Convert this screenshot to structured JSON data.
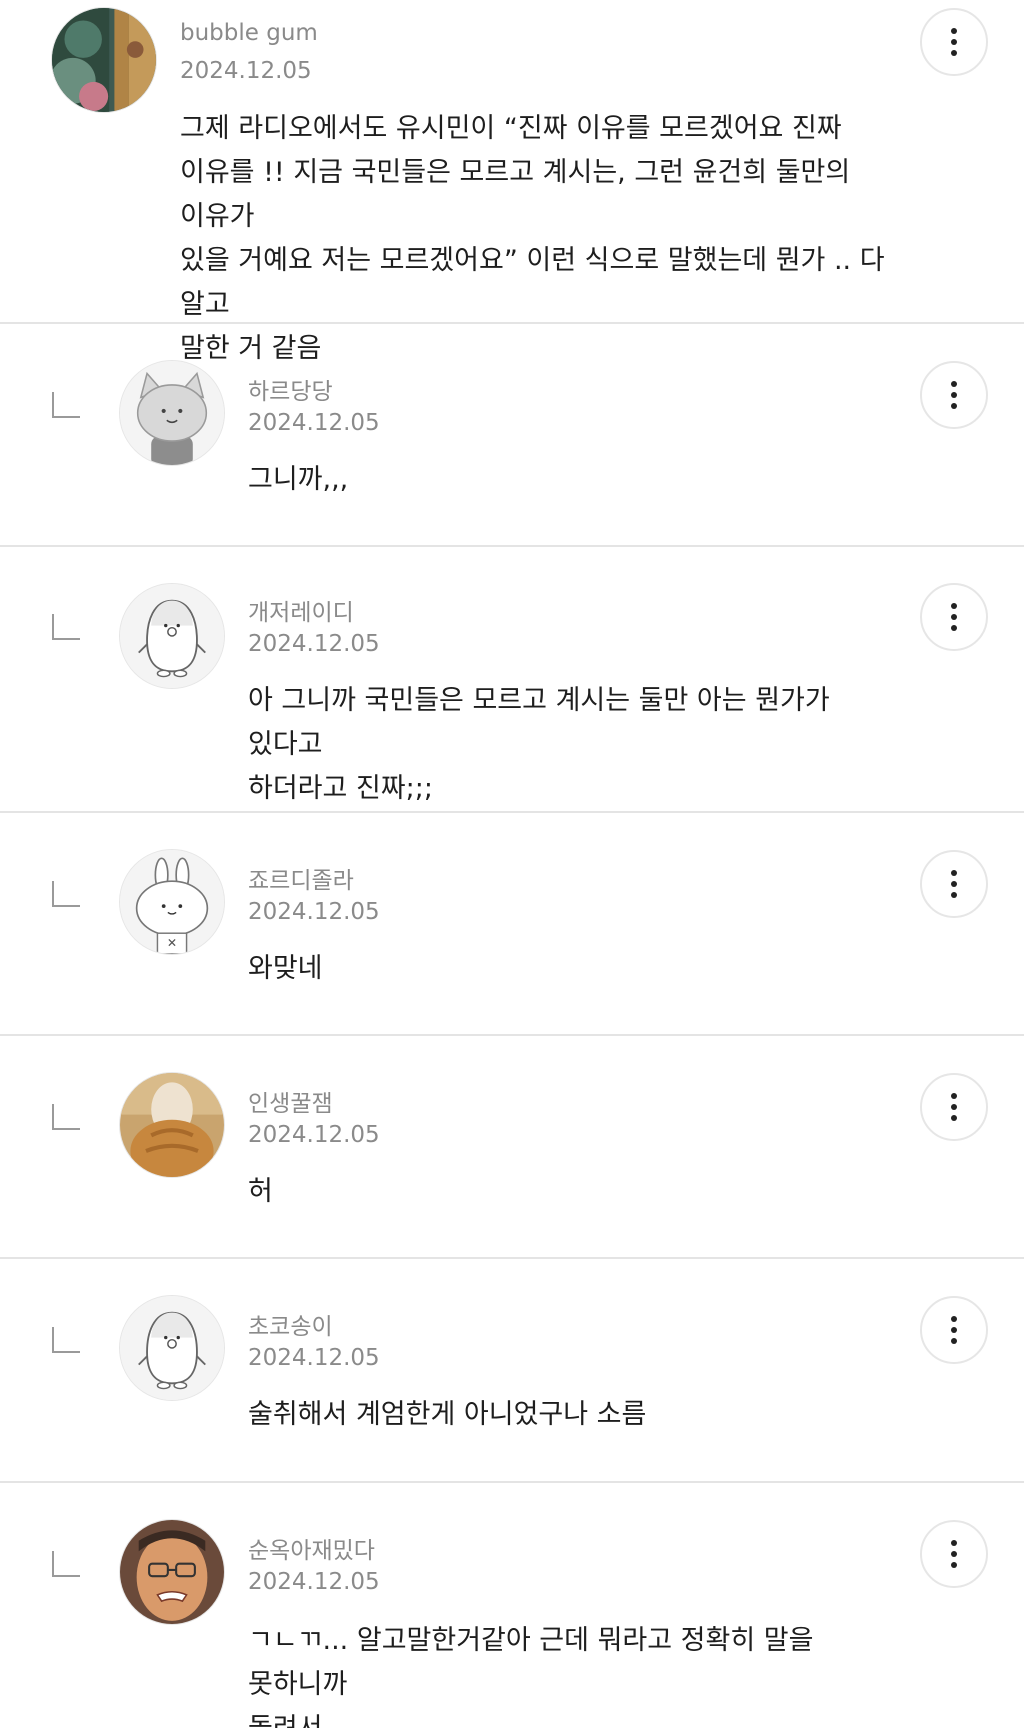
{
  "comments": [
    {
      "author": "bubble gum",
      "date": "2024.12.05",
      "text": "그제 라디오에서도 유시민이 “진짜 이유를 모르겠어요 진짜\n이유를 !! 지금 국민들은 모르고 계시는, 그런 윤건희 둘만의 이유가\n있을 거예요 저는 모르겠어요” 이런 식으로 말했는데 뭔가 .. 다 알고\n말한 거 같음",
      "avatar_icon": "painting-photo-avatar",
      "is_reply": false
    },
    {
      "author": "하르당당",
      "date": "2024.12.05",
      "text": "그니까,,,",
      "avatar_icon": "cat-avatar",
      "is_reply": true
    },
    {
      "author": "개저레이디",
      "date": "2024.12.05",
      "text": "아 그니까 국민들은 모르고 계시는 둘만 아는 뭔가가 있다고\n하더라고 진짜;;;",
      "avatar_icon": "penguin-avatar",
      "is_reply": true
    },
    {
      "author": "죠르디졸라",
      "date": "2024.12.05",
      "text": "와맞네",
      "avatar_icon": "rabbit-avatar",
      "is_reply": true
    },
    {
      "author": "인생꿀잼",
      "date": "2024.12.05",
      "text": "허",
      "avatar_icon": "orange-cat-photo-avatar",
      "is_reply": true
    },
    {
      "author": "초코송이",
      "date": "2024.12.05",
      "text": "술취해서 계엄한게 아니었구나 소름",
      "avatar_icon": "penguin-avatar",
      "is_reply": true
    },
    {
      "author": "순옥아재밌다",
      "date": "2024.12.05",
      "text": "ㄱㄴㄲ... 알고말한거같아 근데 뭐라고 정확히 말을 못하니까\n돌려서..",
      "avatar_icon": "man-photo-avatar",
      "is_reply": true
    }
  ]
}
